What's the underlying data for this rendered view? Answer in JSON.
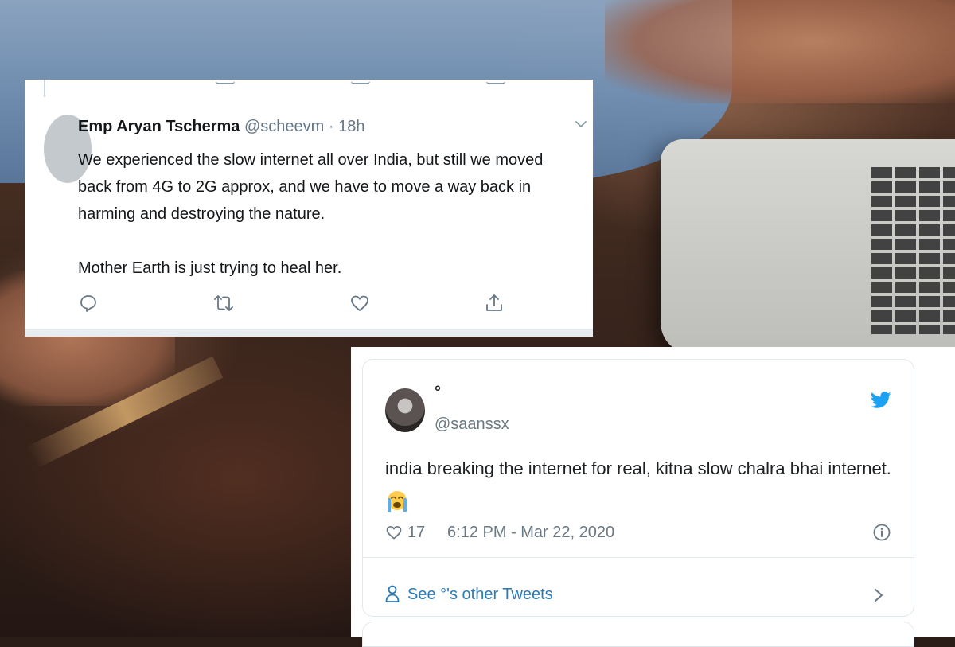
{
  "tweet1": {
    "name": "Emp Aryan Tscherma",
    "handle": "@scheevm",
    "separator": "·",
    "time": "18h",
    "paragraphs": [
      "We experienced the slow internet all over India, but still we moved back from 4G to 2G approx, and we have to move a way back in harming and destroying the nature.",
      "Mother Earth is just trying to heal her."
    ],
    "icons": [
      "reply-icon",
      "retweet-icon",
      "like-icon",
      "share-icon",
      "chevron-down-icon"
    ]
  },
  "tweet2": {
    "display_name": "°",
    "handle": "@saanssx",
    "text": "india breaking the internet for real, kitna slow chalra bhai internet.",
    "emoji": "crying-face",
    "likes": "17",
    "datetime": "6:12 PM - Mar 22, 2020",
    "see_more": "See °'s other Tweets",
    "icons": [
      "twitter-bird-icon",
      "heart-icon",
      "info-icon",
      "person-icon",
      "chevron-right-icon"
    ],
    "colors": {
      "link": "#2b7bb9",
      "bird": "#1da1f2",
      "muted": "#697882"
    }
  }
}
